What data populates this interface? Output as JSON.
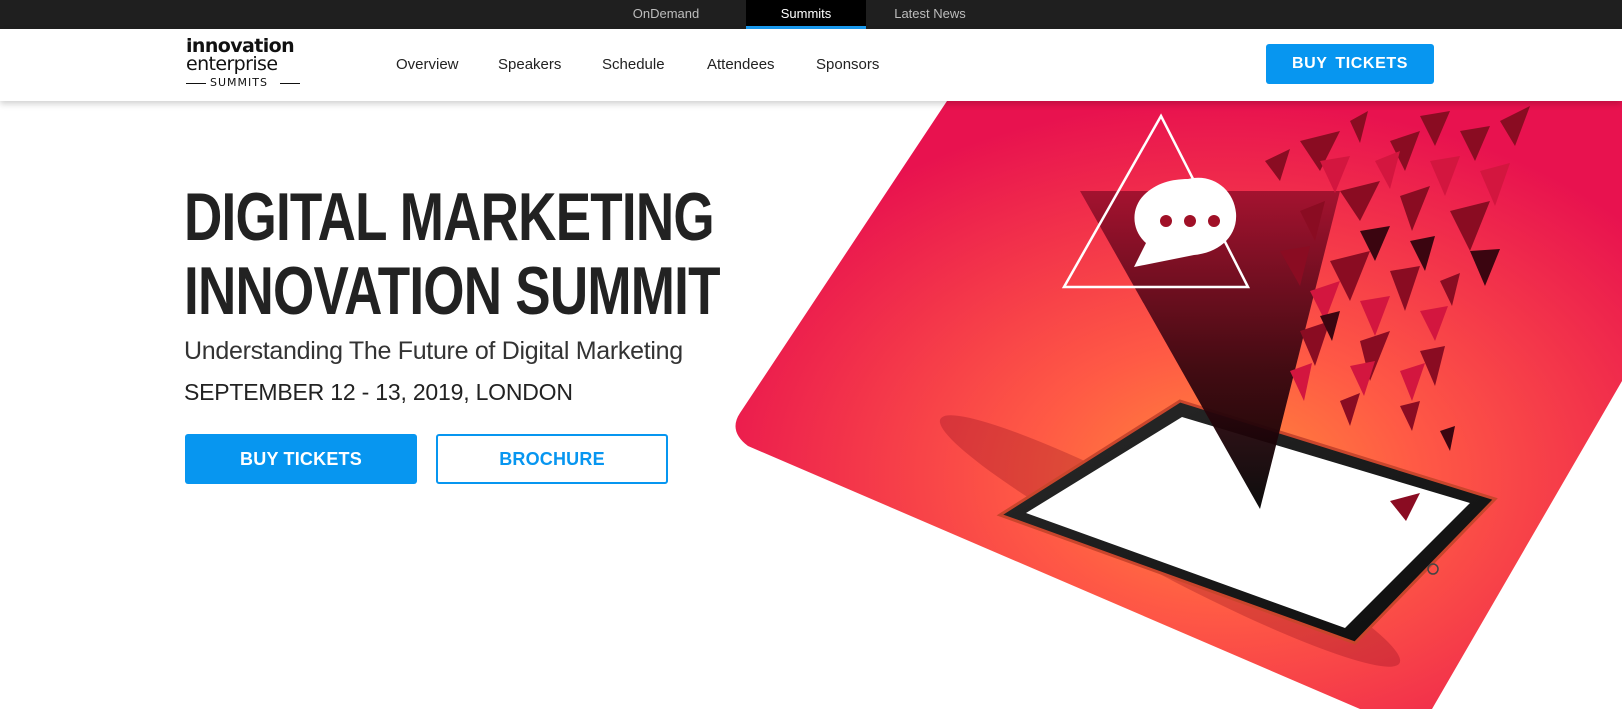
{
  "topbar": {
    "items": [
      {
        "label": "OnDemand"
      },
      {
        "label": "Summits",
        "active": true
      },
      {
        "label": "Latest News"
      }
    ]
  },
  "header": {
    "logo": {
      "line1": "innovation",
      "line2": "enterprise",
      "line3": "SUMMITS"
    },
    "nav": [
      {
        "label": "Overview"
      },
      {
        "label": "Speakers"
      },
      {
        "label": "Schedule"
      },
      {
        "label": "Attendees"
      },
      {
        "label": "Sponsors"
      }
    ],
    "cta_label": "BUY  TICKETS"
  },
  "hero": {
    "title_line1": "DIGITAL MARKETING",
    "title_line2": "INNOVATION SUMMIT",
    "subtitle": "Understanding The Future of Digital Marketing",
    "date": "SEPTEMBER 12 - 13, 2019, LONDON",
    "buy_label": "BUY TICKETS",
    "brochure_label": "BROCHURE"
  },
  "colors": {
    "accent": "#0796f0",
    "topbar": "#1f1f1f",
    "hero_pink": "#e8124f",
    "hero_orange": "#ff6a3d"
  }
}
